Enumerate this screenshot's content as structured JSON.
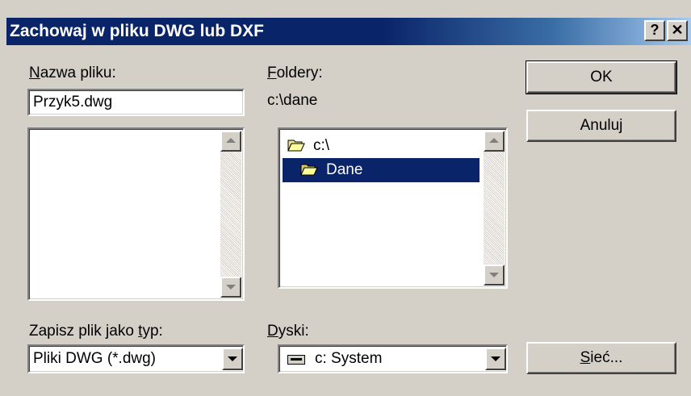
{
  "window": {
    "title": "Zachowaj w pliku DWG lub DXF",
    "help_label": "?",
    "close_label": "✕"
  },
  "filename": {
    "label_mnemonic": "N",
    "label_rest": "azwa pliku:",
    "value": "Przyk5.dwg"
  },
  "folders": {
    "label_mnemonic": "F",
    "label_rest": "oldery:",
    "current_path": "c:\\dane",
    "items": [
      {
        "label": "c:\\",
        "selected": false
      },
      {
        "label": "Dane",
        "selected": true
      }
    ]
  },
  "filetype": {
    "label_start": "Zapisz plik jako ",
    "label_mnemonic": "t",
    "label_rest": "yp:",
    "value": "Pliki DWG (*.dwg)"
  },
  "drives": {
    "label_mnemonic": "D",
    "label_rest": "yski:",
    "value": "c: System"
  },
  "buttons": {
    "ok": "OK",
    "cancel": "Anuluj",
    "network_mnemonic": "S",
    "network_rest": "ieć..."
  },
  "colors": {
    "title_bar": "#0a246a",
    "face": "#d4d0c8",
    "selection": "#0a246a"
  }
}
